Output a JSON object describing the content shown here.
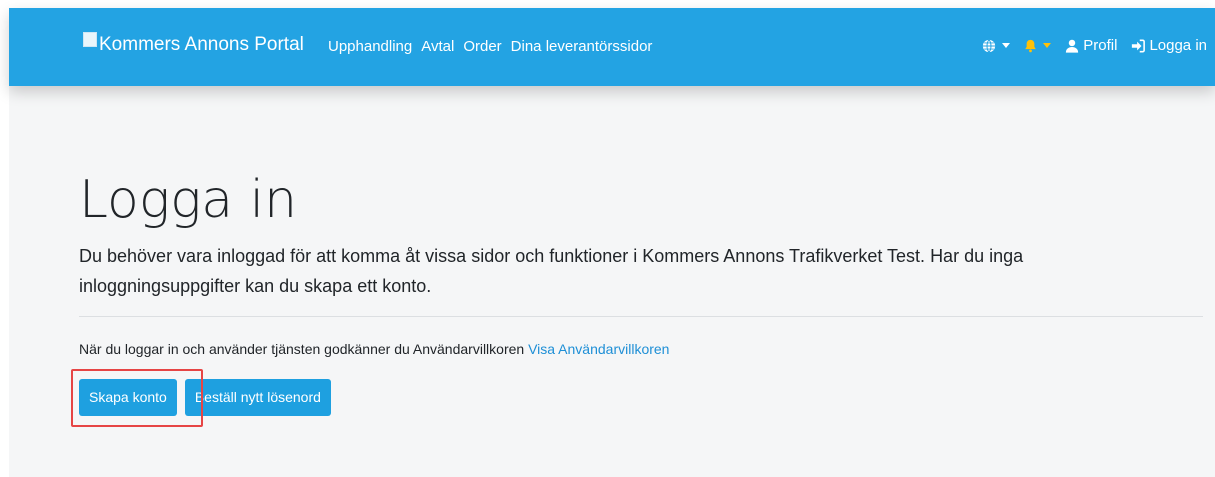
{
  "navbar": {
    "brand": "Kommers Annons Portal",
    "links": [
      "Upphandling",
      "Avtal",
      "Order",
      "Dina leverantörssidor"
    ],
    "profile_label": "Profil",
    "login_label": "Logga in",
    "bell_color": "#ffc107",
    "bg_color": "#23a3e3"
  },
  "main": {
    "title": "Logga in",
    "lead": "Du behöver vara inloggad för att komma åt vissa sidor och funktioner i Kommers Annons Trafikverket Test. Har du inga inloggningsuppgifter kan du skapa ett konto.",
    "terms_text": "När du loggar in och använder tjänsten godkänner du Användarvillkoren",
    "terms_link": "Visa Användarvillkoren",
    "create_account_button": "Skapa konto",
    "reset_password_button": "Beställ nytt lösenord"
  }
}
